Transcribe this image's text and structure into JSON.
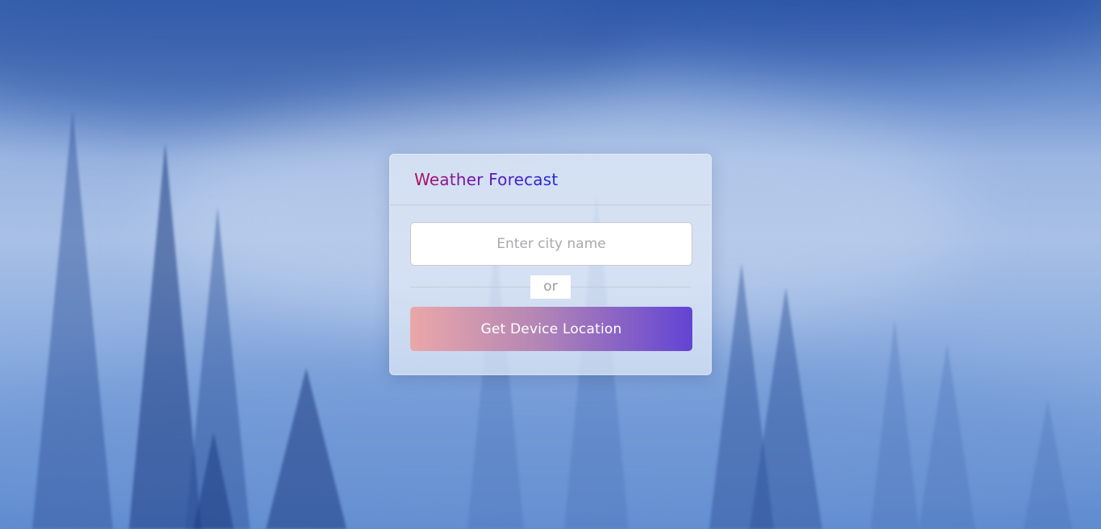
{
  "app": {
    "title": "Weather Forecast"
  },
  "search": {
    "placeholder": "Enter city name",
    "value": ""
  },
  "divider": {
    "label": "or"
  },
  "location_button": {
    "label": "Get Device Location"
  },
  "colors": {
    "title_gradient_start": "#b0135a",
    "title_gradient_end": "#1c2cd6",
    "button_gradient_start": "#eaa7a9",
    "button_gradient_end": "#6244d4",
    "card_background": "#e2eaf6"
  }
}
